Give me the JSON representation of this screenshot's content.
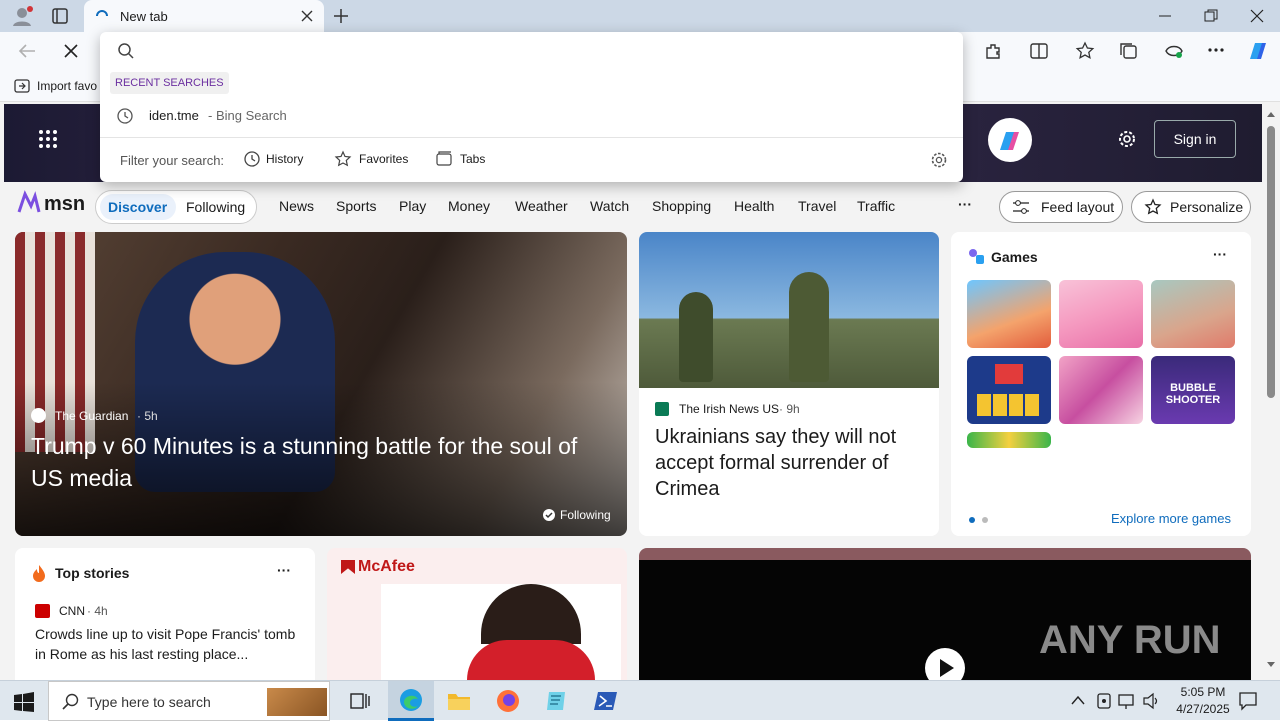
{
  "browser": {
    "tab_title": "New tab",
    "new_tab_symbol": "+",
    "favorites_bar_item": "Import favo",
    "colors": {
      "accent": "#0f6cbd",
      "tab_active": "#f7f9fc",
      "tabstrip": "#ccd8e6"
    }
  },
  "address_dropdown": {
    "recent_header": "RECENT SEARCHES",
    "recent_item": {
      "query": "iden.tme",
      "suffix": "- Bing Search"
    },
    "filter_label": "Filter your search:",
    "filters": [
      "History",
      "Favorites",
      "Tabs"
    ]
  },
  "msn": {
    "sign_in": "Sign in",
    "logo_text": "msn",
    "tabs": {
      "discover": "Discover",
      "following": "Following"
    },
    "nav": [
      "News",
      "Sports",
      "Play",
      "Money",
      "Weather",
      "Watch",
      "Shopping",
      "Health",
      "Travel",
      "Traffic"
    ],
    "more_symbol": "···",
    "feed_layout": "Feed layout",
    "personalize": "Personalize"
  },
  "hero": {
    "source": "The Guardian",
    "age": "· 5h",
    "title": "Trump v 60 Minutes is a stunning battle for the soul of US media",
    "following": "Following"
  },
  "story2": {
    "source": "The Irish News US",
    "age": "· 9h",
    "title": "Ukrainians say they will not accept formal surrender of Crimea"
  },
  "games": {
    "title": "Games",
    "more_symbol": "···",
    "explore": "Explore more games",
    "tile_text": "BUBBLE SHOOTER"
  },
  "top_stories": {
    "title": "Top stories",
    "more_symbol": "···",
    "source": "CNN",
    "age": "· 4h",
    "headline": "Crowds line up to visit Pope Francis' tomb in Rome as his last resting place..."
  },
  "ad": {
    "brand": "McAfee"
  },
  "watermark": "ANY RUN",
  "taskbar": {
    "search_placeholder": "Type here to search",
    "time": "5:05 PM",
    "date": "4/27/2025"
  }
}
